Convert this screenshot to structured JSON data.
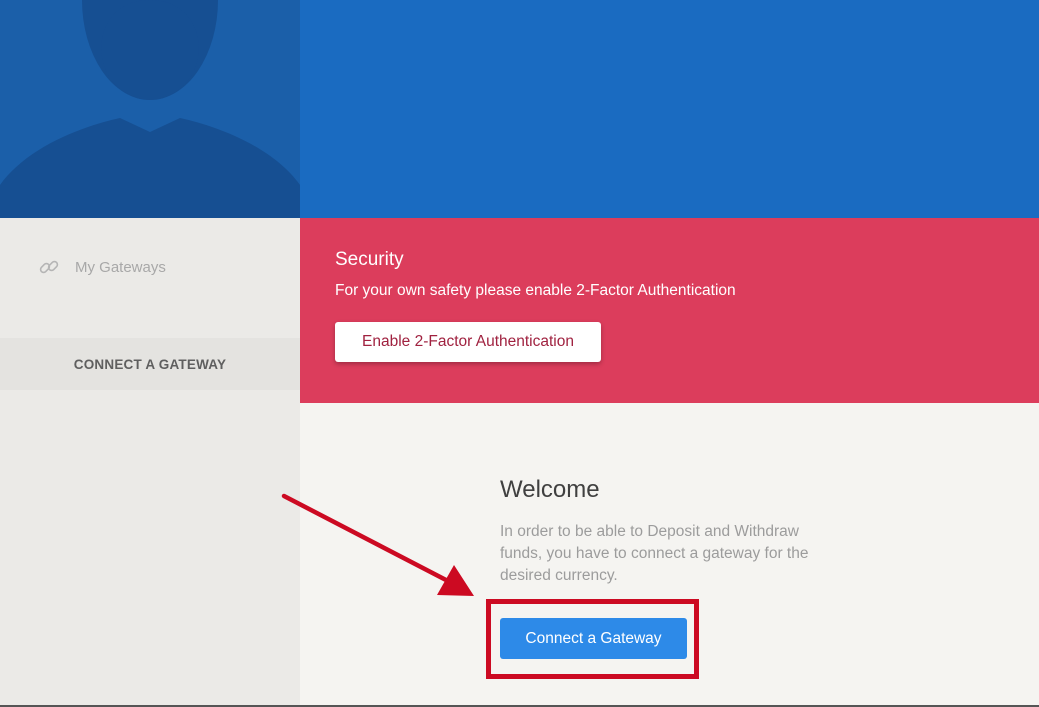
{
  "sidebar": {
    "items": [
      {
        "label": "My Gateways",
        "icon": "link-icon"
      }
    ],
    "connect_label": "CONNECT A GATEWAY"
  },
  "security": {
    "title": "Security",
    "message": "For your own safety please enable 2-Factor Authentication",
    "button_label": "Enable 2-Factor Authentication"
  },
  "welcome": {
    "title": "Welcome",
    "body": "In order to be able to Deposit and Withdraw funds, you have to connect a gateway for the desired currency.",
    "button_label": "Connect a Gateway"
  },
  "colors": {
    "header_blue": "#1a6bc1",
    "avatar_blue": "#1b5fa9",
    "security_red": "#dc3d5c",
    "primary_button": "#2d8ae8",
    "annotation_red": "#cc0a22"
  }
}
